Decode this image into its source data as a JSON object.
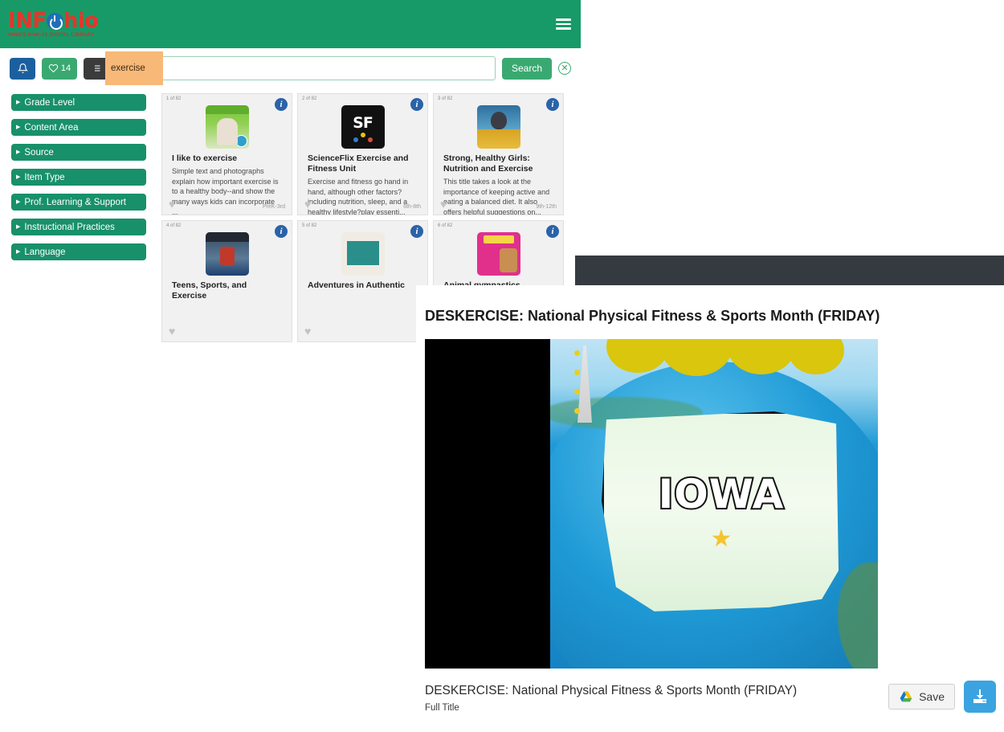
{
  "header": {
    "logo_part1": "INF",
    "logo_part2": "hio",
    "logo_subtitle": "OHIO'S PreK-12 DIGITAL LIBRARY",
    "menu_icon": "hamburger-menu-icon",
    "brand_green": "#189a68",
    "brand_red": "#e8342a",
    "brand_blue": "#1f6fb5"
  },
  "search": {
    "bell_icon": "notification-bell-icon",
    "favorites_count": "14",
    "favorites_icon": "heart-icon",
    "list_icon": "list-lines-icon",
    "input_value": "",
    "input_placeholder": "",
    "search_label": "Search",
    "clear_icon": "circle-x-clear-icon",
    "autocomplete_text": "exercise"
  },
  "facets": {
    "items": [
      {
        "label": "Grade Level"
      },
      {
        "label": "Content Area"
      },
      {
        "label": "Source"
      },
      {
        "label": "Item Type"
      },
      {
        "label": "Prof. Learning & Support"
      },
      {
        "label": "Instructional Practices"
      },
      {
        "label": "Language"
      }
    ]
  },
  "results": {
    "cards": [
      {
        "count": "1 of 82",
        "title": "I like to exercise",
        "description": "Simple text and photographs explain how important exercise is to a healthy body--and show the many ways kids can incorporate ...",
        "grade": "PreK-3rd",
        "info_icon": "info-circle-icon",
        "favorite_icon": "heart-icon"
      },
      {
        "count": "2 of 82",
        "title": "ScienceFlix Exercise and Fitness Unit",
        "description": "Exercise and fitness go hand in hand, although other factors? including nutrition, sleep, and a healthy lifestyle?play essenti...",
        "grade": "6th-8th",
        "info_icon": "info-circle-icon",
        "favorite_icon": "heart-icon"
      },
      {
        "count": "3 of 82",
        "title": "Strong, Healthy Girls: Nutrition and Exercise",
        "description": "This title takes a look at the importance of keeping active and eating a balanced diet. It also offers helpful suggestions on...",
        "grade": "9th-12th",
        "info_icon": "info-circle-icon",
        "favorite_icon": "heart-icon"
      },
      {
        "count": "4 of 82",
        "title": "Teens, Sports, and Exercise",
        "description": "",
        "grade": "",
        "info_icon": "info-circle-icon",
        "favorite_icon": "heart-icon"
      },
      {
        "count": "5 of 82",
        "title": "Adventures in Authentic",
        "description": "",
        "grade": "",
        "info_icon": "info-circle-icon",
        "favorite_icon": "heart-icon"
      },
      {
        "count": "6 of 82",
        "title": "Animal gymnastics",
        "description": "",
        "grade": "",
        "info_icon": "info-circle-icon",
        "favorite_icon": "heart-icon"
      }
    ]
  },
  "detail": {
    "title": "DESKERCISE: National Physical Fitness & Sports Month (FRIDAY)",
    "media_caption_text": "IOWA",
    "footer_title": "DESKERCISE: National Physical Fitness & Sports Month (FRIDAY)",
    "footer_subtitle": "Full Title",
    "save_label": "Save",
    "save_icon": "google-drive-icon",
    "download_icon": "download-tray-icon",
    "download_color": "#3ba3e0",
    "darkbar_color": "#343a40"
  }
}
